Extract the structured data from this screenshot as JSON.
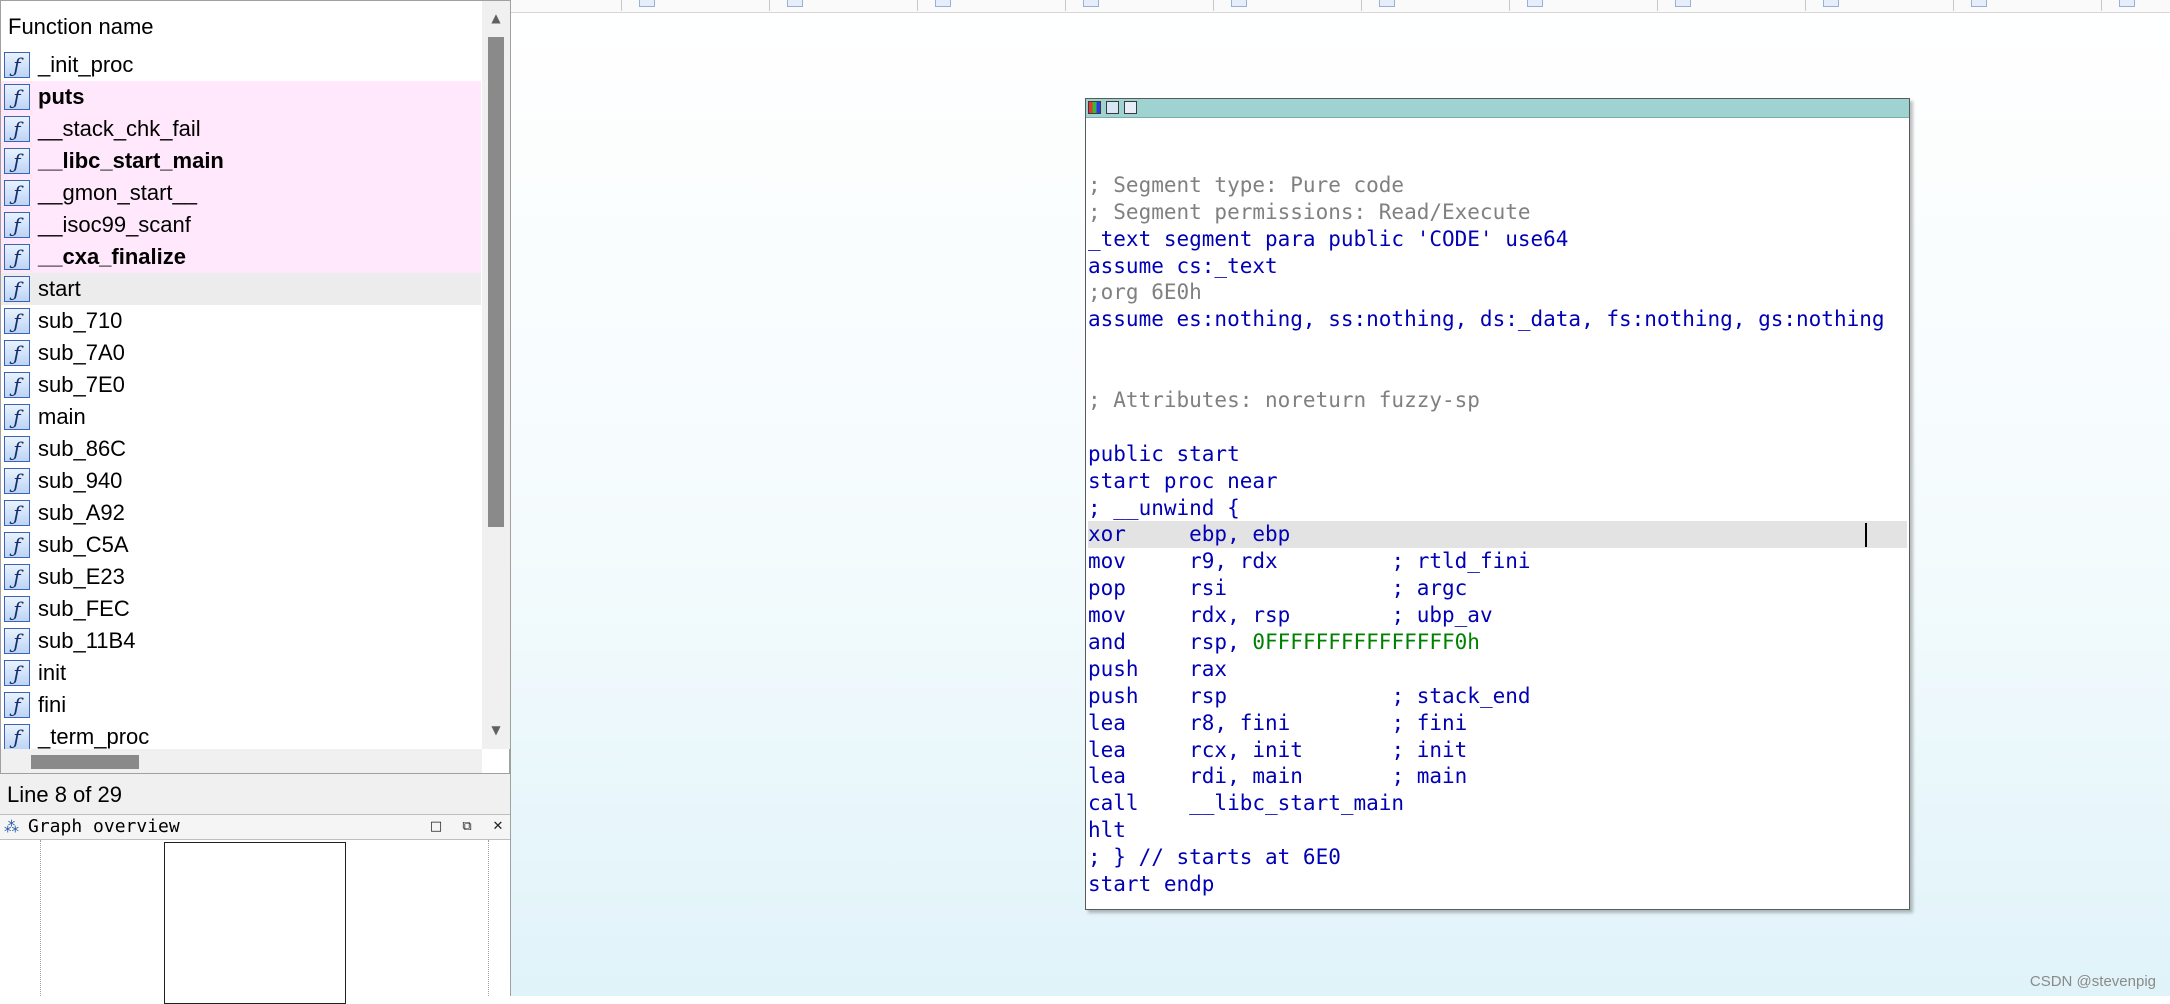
{
  "functions_panel": {
    "header": "Function name",
    "icon_glyph": "ƒ",
    "rows": [
      {
        "name": "_init_proc",
        "style": "normal"
      },
      {
        "name": "puts",
        "style": "lib-bold"
      },
      {
        "name": "__stack_chk_fail",
        "style": "lib"
      },
      {
        "name": "__libc_start_main",
        "style": "lib-bold"
      },
      {
        "name": "__gmon_start__",
        "style": "lib"
      },
      {
        "name": "__isoc99_scanf",
        "style": "lib"
      },
      {
        "name": "__cxa_finalize",
        "style": "lib-bold"
      },
      {
        "name": "start",
        "style": "selected"
      },
      {
        "name": "sub_710",
        "style": "normal"
      },
      {
        "name": "sub_7A0",
        "style": "normal"
      },
      {
        "name": "sub_7E0",
        "style": "normal"
      },
      {
        "name": "main",
        "style": "normal"
      },
      {
        "name": "sub_86C",
        "style": "normal"
      },
      {
        "name": "sub_940",
        "style": "normal"
      },
      {
        "name": "sub_A92",
        "style": "normal"
      },
      {
        "name": "sub_C5A",
        "style": "normal"
      },
      {
        "name": "sub_E23",
        "style": "normal"
      },
      {
        "name": "sub_FEC",
        "style": "normal"
      },
      {
        "name": "sub_11B4",
        "style": "normal"
      },
      {
        "name": "init",
        "style": "normal"
      },
      {
        "name": "fini",
        "style": "normal"
      },
      {
        "name": "_term_proc",
        "style": "normal"
      }
    ],
    "status": "Line 8 of 29"
  },
  "graph_overview": {
    "title": "Graph overview",
    "buttons": [
      "□",
      "⧉",
      "✕"
    ]
  },
  "colors": {
    "lib_row_bg": "#ffe8fc",
    "selected_row_bg": "#ececec",
    "code_blue": "#0000b4",
    "code_comment": "#808080",
    "code_number": "#008000",
    "titlebar_teal": "#9ed3d1"
  },
  "code_view": {
    "lines": [
      {
        "parts": [
          {
            "t": "",
            "c": "code"
          }
        ]
      },
      {
        "parts": [
          {
            "t": "; Segment type: Pure code",
            "c": "cmt"
          }
        ]
      },
      {
        "parts": [
          {
            "t": "; Segment permissions: Read/Execute",
            "c": "cmt"
          }
        ]
      },
      {
        "parts": [
          {
            "t": "_text segment para public 'CODE' use64",
            "c": "code"
          }
        ]
      },
      {
        "parts": [
          {
            "t": "assume cs:_text",
            "c": "code"
          }
        ]
      },
      {
        "parts": [
          {
            "t": ";org 6E0h",
            "c": "cmt"
          }
        ]
      },
      {
        "parts": [
          {
            "t": "assume es:nothing, ss:nothing, ds:_data, fs:nothing, gs:nothing",
            "c": "code"
          }
        ]
      },
      {
        "parts": [
          {
            "t": "",
            "c": "code"
          }
        ]
      },
      {
        "parts": [
          {
            "t": "",
            "c": "code"
          }
        ]
      },
      {
        "parts": [
          {
            "t": "; Attributes: noreturn fuzzy-sp",
            "c": "cmt"
          }
        ]
      },
      {
        "parts": [
          {
            "t": "",
            "c": "code"
          }
        ]
      },
      {
        "parts": [
          {
            "t": "public start",
            "c": "code"
          }
        ]
      },
      {
        "parts": [
          {
            "t": "start proc near",
            "c": "code"
          }
        ]
      },
      {
        "parts": [
          {
            "t": "; __unwind {",
            "c": "code"
          }
        ]
      },
      {
        "parts": [
          {
            "t": "xor     ebp, ebp",
            "c": "code"
          }
        ],
        "highlight": true
      },
      {
        "parts": [
          {
            "t": "mov     r9, rdx         ",
            "c": "code"
          },
          {
            "t": "; rtld_fini",
            "c": "code"
          }
        ]
      },
      {
        "parts": [
          {
            "t": "pop     rsi             ",
            "c": "code"
          },
          {
            "t": "; argc",
            "c": "code"
          }
        ]
      },
      {
        "parts": [
          {
            "t": "mov     rdx, rsp        ",
            "c": "code"
          },
          {
            "t": "; ubp_av",
            "c": "code"
          }
        ]
      },
      {
        "parts": [
          {
            "t": "and     rsp, ",
            "c": "code"
          },
          {
            "t": "0FFFFFFFFFFFFFFF0h",
            "c": "num"
          }
        ]
      },
      {
        "parts": [
          {
            "t": "push    rax",
            "c": "code"
          }
        ]
      },
      {
        "parts": [
          {
            "t": "push    rsp             ",
            "c": "code"
          },
          {
            "t": "; stack_end",
            "c": "code"
          }
        ]
      },
      {
        "parts": [
          {
            "t": "lea     r8, fini        ",
            "c": "code"
          },
          {
            "t": "; fini",
            "c": "code"
          }
        ]
      },
      {
        "parts": [
          {
            "t": "lea     rcx, init       ",
            "c": "code"
          },
          {
            "t": "; init",
            "c": "code"
          }
        ]
      },
      {
        "parts": [
          {
            "t": "lea     rdi, main       ",
            "c": "code"
          },
          {
            "t": "; main",
            "c": "code"
          }
        ]
      },
      {
        "parts": [
          {
            "t": "call    __libc_start_main",
            "c": "code"
          }
        ]
      },
      {
        "parts": [
          {
            "t": "hlt",
            "c": "code"
          }
        ]
      },
      {
        "parts": [
          {
            "t": "; } // starts at 6E0",
            "c": "code"
          }
        ]
      },
      {
        "parts": [
          {
            "t": "start endp",
            "c": "code"
          }
        ]
      }
    ]
  },
  "watermark": "CSDN @stevenpig"
}
